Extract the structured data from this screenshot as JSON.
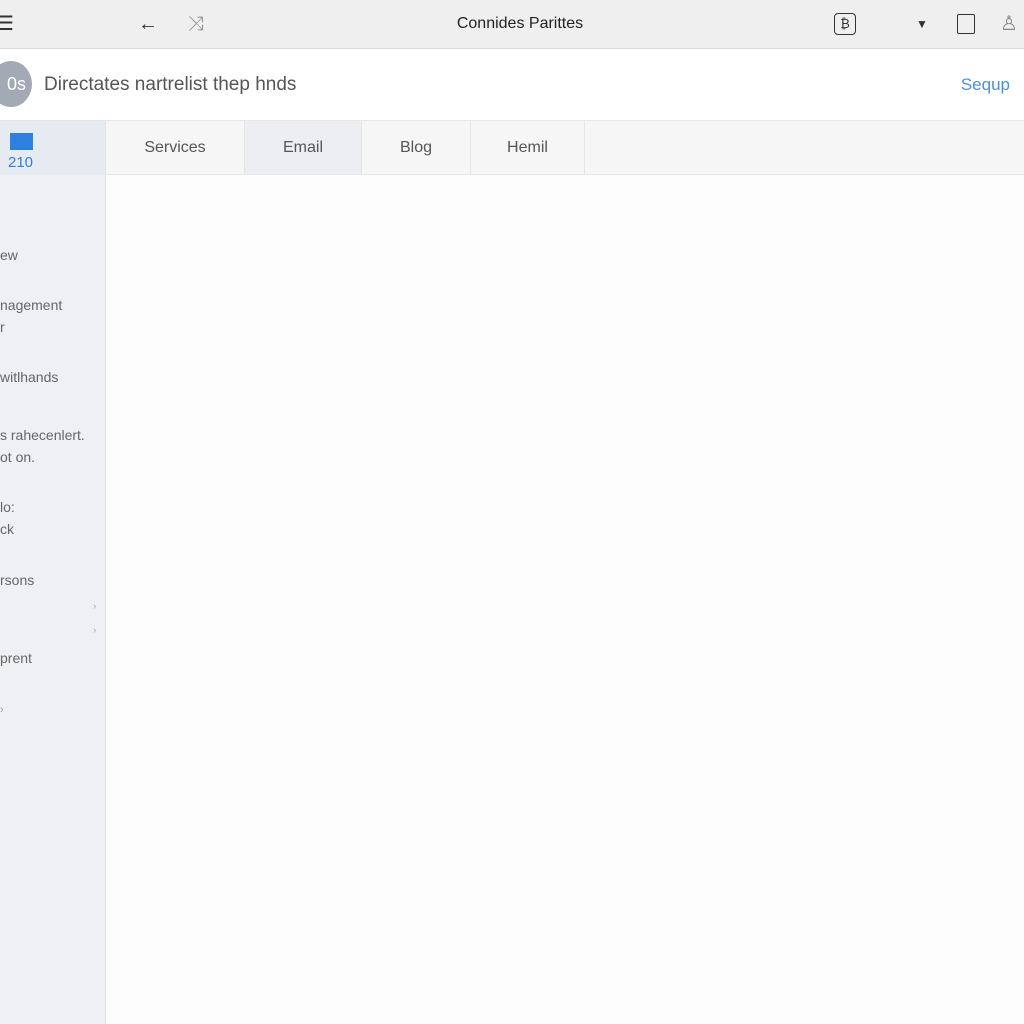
{
  "topbar": {
    "title": "Connides Parittes",
    "icons": [
      "menu-icon",
      "back-arrow-icon",
      "shuffle-icon",
      "tablet-icon",
      "dropdown-caret-icon",
      "bag-icon",
      "user-icon"
    ]
  },
  "header": {
    "avatar_text": "0s",
    "title": "Directates nartrelist thep hnds",
    "action": "Sequp"
  },
  "sidebar": {
    "badge_number": "210",
    "items": [
      "ew",
      "nagement",
      "r",
      "witlhands",
      "s rahecenlert.",
      "ot on.",
      "lo:",
      "ck",
      "rsons",
      "prent",
      "›"
    ]
  },
  "tabs": [
    {
      "label": "Services",
      "active": false
    },
    {
      "label": "Email",
      "active": true
    },
    {
      "label": "Blog",
      "active": false
    },
    {
      "label": "Hemil",
      "active": false
    }
  ],
  "colors": {
    "accent": "#2f7fe0",
    "link": "#4a90d9"
  }
}
